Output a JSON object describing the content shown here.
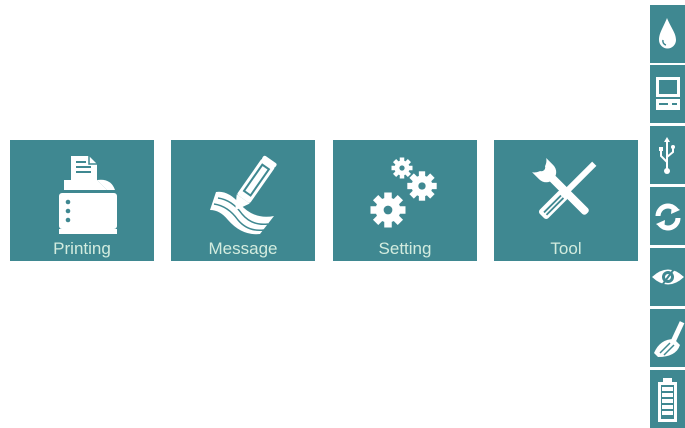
{
  "tiles": [
    {
      "label": "Printing",
      "icon": "printer-icon"
    },
    {
      "label": "Message",
      "icon": "edit-message-icon"
    },
    {
      "label": "Setting",
      "icon": "gears-icon"
    },
    {
      "label": "Tool",
      "icon": "tools-icon"
    }
  ],
  "sidebar": {
    "items": [
      {
        "icon": "ink-drop-icon"
      },
      {
        "icon": "computer-icon"
      },
      {
        "icon": "usb-icon"
      },
      {
        "icon": "refresh-icon"
      },
      {
        "icon": "eye-icon"
      },
      {
        "icon": "brush-icon"
      },
      {
        "icon": "battery-icon"
      }
    ]
  },
  "colors": {
    "tile_bg": "#3f8891",
    "label_text": "#d3ecdf",
    "icon_fill": "#ffffff"
  }
}
